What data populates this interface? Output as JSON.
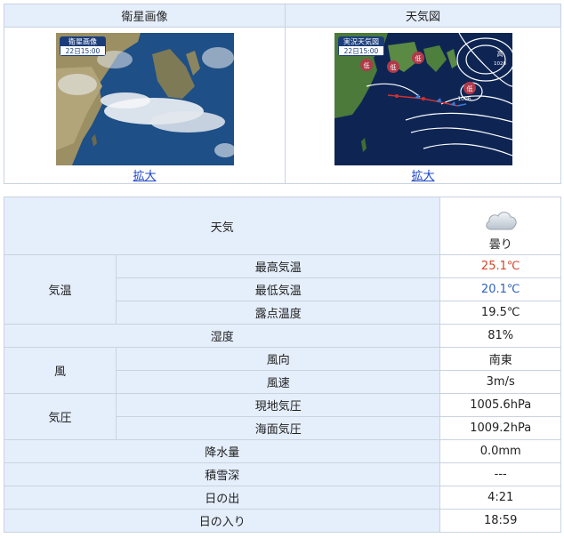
{
  "images": {
    "satellite": {
      "header": "衛星画像",
      "badge_title": "衛星画像",
      "badge_time": "22日15:00",
      "enlarge_label": "拡大"
    },
    "weather_map": {
      "header": "天気図",
      "badge_title": "実況天気図",
      "badge_time": "22日15:00",
      "enlarge_label": "拡大",
      "low_label": "低",
      "high_label": "高",
      "pressure_low": "1006",
      "pressure_high": "1028"
    }
  },
  "weather": {
    "label": "天気",
    "value": "曇り",
    "icon": "cloud-icon"
  },
  "temperature": {
    "group_label": "気温",
    "max_label": "最高気温",
    "max_value": "25.1℃",
    "min_label": "最低気温",
    "min_value": "20.1℃",
    "dew_label": "露点温度",
    "dew_value": "19.5℃"
  },
  "humidity": {
    "label": "湿度",
    "value": "81%"
  },
  "wind": {
    "group_label": "風",
    "dir_label": "風向",
    "dir_value": "南東",
    "speed_label": "風速",
    "speed_value": "3m/s"
  },
  "pressure": {
    "group_label": "気圧",
    "station_label": "現地気圧",
    "station_value": "1005.6hPa",
    "sea_label": "海面気圧",
    "sea_value": "1009.2hPa"
  },
  "precipitation": {
    "label": "降水量",
    "value": "0.0mm"
  },
  "snow": {
    "label": "積雪深",
    "value": "---"
  },
  "sunrise": {
    "label": "日の出",
    "value": "4:21"
  },
  "sunset": {
    "label": "日の入り",
    "value": "18:59"
  },
  "colors": {
    "header_bg": "#e5eefb",
    "max_temp": "#d0452a",
    "min_temp": "#2f62b8",
    "link": "#1a44c8"
  }
}
